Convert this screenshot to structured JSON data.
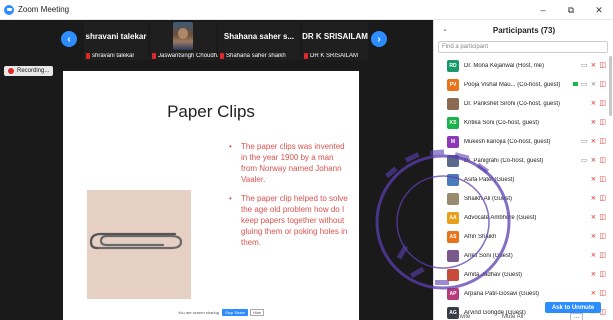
{
  "window": {
    "title": "Zoom Meeting",
    "minimize": "–",
    "maximize": "⧉",
    "close": "✕"
  },
  "meeting": {
    "recording_label": "Recording...",
    "nav_prev": "‹",
    "nav_next": "›",
    "tiles": [
      {
        "name": "shravani talekar",
        "label": "shravani talekar"
      },
      {
        "name": "",
        "label": "Jaswantsingh Choudh..."
      },
      {
        "name": "Shahana saher s...",
        "label": "Shahana saher shaikh"
      },
      {
        "name": "DR K SRISAILAM",
        "label": "DR K SRISAILAM"
      }
    ],
    "share_bar": {
      "info": "You are screen sharing",
      "stop": "Stop Share",
      "hide": "Hide"
    }
  },
  "slide": {
    "title": "Paper Clips",
    "bullets": [
      "The paper clips was invented in the year 1900 by a man from Norway named Johann Vaaler.",
      "The paper clip helped to solve the age old problem how do I keep papers together without gluing them or poking holes in them."
    ],
    "accent_color": "#d9534f"
  },
  "participants": {
    "title": "Participants (73)",
    "collapse_icon": "⌄",
    "search_placeholder": "Find a participant",
    "items": [
      {
        "initials": "RD",
        "color": "#1a9a6c",
        "name": "Dr. Mona Kejariwal (Host, me)",
        "video": "on",
        "muted": true
      },
      {
        "initials": "PV",
        "color": "#e8731a",
        "name": "Pooja Vishal Mau... (Co-host, guest)",
        "video": "on",
        "muted": false,
        "sharing": true
      },
      {
        "initials": "",
        "color": "#8a6a50",
        "name": "Dr. Parikshet Sirohi (Co-host, guest)",
        "video": "off",
        "muted": true
      },
      {
        "initials": "KS",
        "color": "#1ab24a",
        "name": "Kritika Soni (Co-host, guest)",
        "video": "off",
        "muted": true
      },
      {
        "initials": "M",
        "color": "#8e3ab8",
        "name": "Mukesh kanojia (Co-host, guest)",
        "video": "on",
        "muted": true
      },
      {
        "initials": "",
        "color": "#5a6a8a",
        "name": "Dr. Panigrahi (Co-host, guest)",
        "video": "on",
        "muted": true
      },
      {
        "initials": "",
        "color": "#4a7ab8",
        "name": "Asifa Patel (Guest)",
        "video": "off",
        "muted": true
      },
      {
        "initials": "",
        "color": "#9a8a70",
        "name": "Shaikh Ali (Guest)",
        "video": "off",
        "muted": true
      },
      {
        "initials": "AA",
        "color": "#e8a01a",
        "name": "Advocate Ambhore (Guest)",
        "video": "off",
        "muted": true
      },
      {
        "initials": "AS",
        "color": "#e8731a",
        "name": "Afrin Shaikh",
        "video": "off",
        "muted": true
      },
      {
        "initials": "",
        "color": "#7a5a8a",
        "name": "Ankit Soni (Guest)",
        "video": "off",
        "muted": true
      },
      {
        "initials": "",
        "color": "#c84a3a",
        "name": "Amita Jadhav (Guest)",
        "video": "off",
        "muted": true
      },
      {
        "initials": "AP",
        "color": "#b83a7a",
        "name": "Arpana Patil-Gosavi (Guest)",
        "video": "off",
        "muted": true
      },
      {
        "initials": "AG",
        "color": "#3a3a4a",
        "name": "Arvind Gongde (Guest)",
        "video": "off",
        "muted": true
      }
    ],
    "ask_to_unmute": "Ask to Unmute",
    "footer": {
      "invite": "Invite",
      "mute_all": "Mute All",
      "more": "..."
    }
  },
  "stamp": {
    "text": "Bandra (E) Mumbai-50, D. S. M. Baburao"
  },
  "icons": {
    "video": "▭",
    "muted_mic": "🎙",
    "search": "search-icon"
  }
}
